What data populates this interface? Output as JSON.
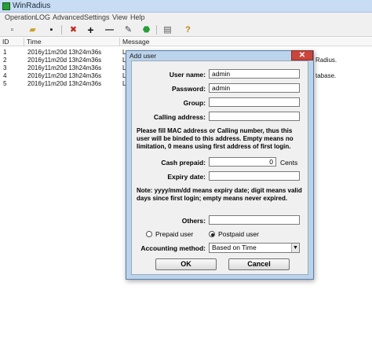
{
  "window": {
    "title": "WinRadius"
  },
  "menu": [
    "Operation",
    "LOG",
    "Advanced",
    "Settings",
    "View",
    "Help"
  ],
  "toolbar": {
    "icons": [
      "new-icon",
      "open-icon",
      "save-icon",
      "delete-icon",
      "add-icon",
      "remove-icon",
      "edit-icon",
      "globe-icon",
      "print-icon",
      "help-icon"
    ],
    "glyphs": [
      "▫",
      "▰",
      "▪",
      "✖",
      "+",
      "—",
      "✎",
      "⬣",
      "▤",
      "?"
    ]
  },
  "list": {
    "columns": [
      "ID",
      "Time",
      "Message"
    ],
    "rows": [
      {
        "id": "1",
        "time": "2016y11m20d 13h24m36s",
        "msg": "L"
      },
      {
        "id": "2",
        "time": "2016y11m20d 13h24m36s",
        "msg": "L"
      },
      {
        "id": "3",
        "time": "2016y11m20d 13h24m36s",
        "msg": "L"
      },
      {
        "id": "4",
        "time": "2016y11m20d 13h24m36s",
        "msg": "L"
      },
      {
        "id": "5",
        "time": "2016y11m20d 13h24m36s",
        "msg": "L"
      }
    ],
    "right_fragments": [
      "Radius.",
      "tabase."
    ]
  },
  "dialog": {
    "title": "Add user",
    "close_label": "✕",
    "username_label": "User name:",
    "username_value": "admin",
    "password_label": "Password:",
    "password_value": "admin",
    "group_label": "Group:",
    "group_value": "",
    "calling_label": "Calling address:",
    "calling_value": "",
    "note1": "Please fill MAC address or Calling number, thus this user will be binded to this address. Empty means no limitation, 0 means using first address of first login.",
    "cash_label": "Cash prepaid:",
    "cash_value": "0",
    "cash_unit": "Cents",
    "expiry_label": "Expiry date:",
    "expiry_value": "",
    "note2": "Note: yyyy/mm/dd means expiry date; digit means valid days since first login; empty means never expired.",
    "others_label": "Others:",
    "others_value": "",
    "prepaid_label": "Prepaid user",
    "postpaid_label": "Postpaid user",
    "selected_user_type": "postpaid",
    "accounting_label": "Accounting method:",
    "accounting_value": "Based on Time",
    "ok_label": "OK",
    "cancel_label": "Cancel"
  }
}
